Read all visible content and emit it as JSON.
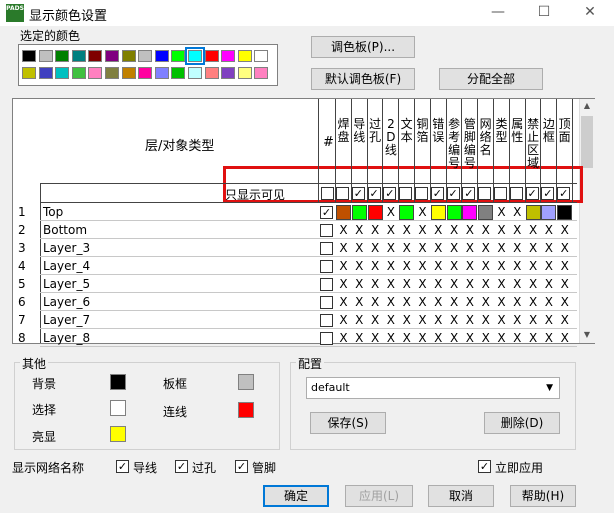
{
  "window": {
    "title": "显示颜色设置",
    "min": "—",
    "max": "☐",
    "close": "✕",
    "icon_text": "PADS"
  },
  "selected_colors": {
    "label": "选定的颜色",
    "row1": [
      "#000000",
      "#c0c0c0",
      "#007f00",
      "#007f7f",
      "#7f0000",
      "#7f007f",
      "#7f7f00",
      "#c0c0c0",
      "#0000ff",
      "#00ff00",
      "#00ffff",
      "#ff0000",
      "#ff00ff",
      "#ffff00",
      "#ffffff"
    ],
    "row2": [
      "#c0c000",
      "#4040c0",
      "#00c0c0",
      "#40c040",
      "#ff80c0",
      "#808040",
      "#c08000",
      "#ff00a0",
      "#8080ff",
      "#00c000",
      "#c0ffff",
      "#ff8080",
      "#8040c0",
      "#ffff80",
      "#ff80c0"
    ]
  },
  "buttons": {
    "palette": "调色板(P)...",
    "default_palette": "默认调色板(F)",
    "assign_all": "分配全部",
    "save": "保存(S)",
    "delete": "删除(D)",
    "ok": "确定",
    "apply": "应用(L)",
    "cancel": "取消",
    "help": "帮助(H)"
  },
  "grid": {
    "header_label": "层/对象类型",
    "hash_col": "#",
    "columns": [
      "焊盘",
      "导线",
      "过孔",
      "2D线",
      "文本",
      "铜箔",
      "错误",
      "参考编号",
      "管脚编号",
      "网络名",
      "类型",
      "属性",
      "禁止区域",
      "边框",
      "顶面"
    ],
    "visible_only_label": "只显示可见",
    "visible_only_checks": [
      false,
      true,
      true,
      true,
      false,
      false,
      true,
      true,
      true,
      false,
      false,
      false,
      true,
      true,
      true
    ],
    "rows": [
      {
        "num": "1",
        "name": "Top",
        "checked": true,
        "cells": [
          "#c05000",
          "#00ff00",
          "#ff0000",
          "X",
          "#00ff00",
          "X",
          "#ffff00",
          "#00ff00",
          "#ff00ff",
          "#808080",
          "X",
          "X",
          "#c0c000",
          "#a0a0ff",
          "#000000"
        ]
      },
      {
        "num": "2",
        "name": "Bottom",
        "checked": false,
        "cells": [
          "X",
          "X",
          "X",
          "X",
          "X",
          "X",
          "X",
          "X",
          "X",
          "X",
          "X",
          "X",
          "X",
          "X",
          "X"
        ]
      },
      {
        "num": "3",
        "name": "Layer_3",
        "checked": false,
        "cells": [
          "X",
          "X",
          "X",
          "X",
          "X",
          "X",
          "X",
          "X",
          "X",
          "X",
          "X",
          "X",
          "X",
          "X",
          "X"
        ]
      },
      {
        "num": "4",
        "name": "Layer_4",
        "checked": false,
        "cells": [
          "X",
          "X",
          "X",
          "X",
          "X",
          "X",
          "X",
          "X",
          "X",
          "X",
          "X",
          "X",
          "X",
          "X",
          "X"
        ]
      },
      {
        "num": "5",
        "name": "Layer_5",
        "checked": false,
        "cells": [
          "X",
          "X",
          "X",
          "X",
          "X",
          "X",
          "X",
          "X",
          "X",
          "X",
          "X",
          "X",
          "X",
          "X",
          "X"
        ]
      },
      {
        "num": "6",
        "name": "Layer_6",
        "checked": false,
        "cells": [
          "X",
          "X",
          "X",
          "X",
          "X",
          "X",
          "X",
          "X",
          "X",
          "X",
          "X",
          "X",
          "X",
          "X",
          "X"
        ]
      },
      {
        "num": "7",
        "name": "Layer_7",
        "checked": false,
        "cells": [
          "X",
          "X",
          "X",
          "X",
          "X",
          "X",
          "X",
          "X",
          "X",
          "X",
          "X",
          "X",
          "X",
          "X",
          "X"
        ]
      },
      {
        "num": "8",
        "name": "Layer_8",
        "checked": false,
        "cells": [
          "X",
          "X",
          "X",
          "X",
          "X",
          "X",
          "X",
          "X",
          "X",
          "X",
          "X",
          "X",
          "X",
          "X",
          "X"
        ]
      }
    ]
  },
  "other": {
    "label": "其他",
    "background": "背景",
    "background_color": "#000000",
    "board_frame": "板框",
    "board_frame_color": "#c0c0c0",
    "selection": "选择",
    "selection_color": "#ffffff",
    "connection": "连线",
    "connection_color": "#ff0000",
    "highlight": "亮显",
    "highlight_color": "#ffff00"
  },
  "config": {
    "label": "配置",
    "value": "default"
  },
  "net_names": {
    "label": "显示网络名称",
    "trace": "导线",
    "via": "过孔",
    "pin": "管脚",
    "trace_checked": true,
    "via_checked": true,
    "pin_checked": true
  },
  "immediate_apply": {
    "label": "立即应用",
    "checked": true
  }
}
